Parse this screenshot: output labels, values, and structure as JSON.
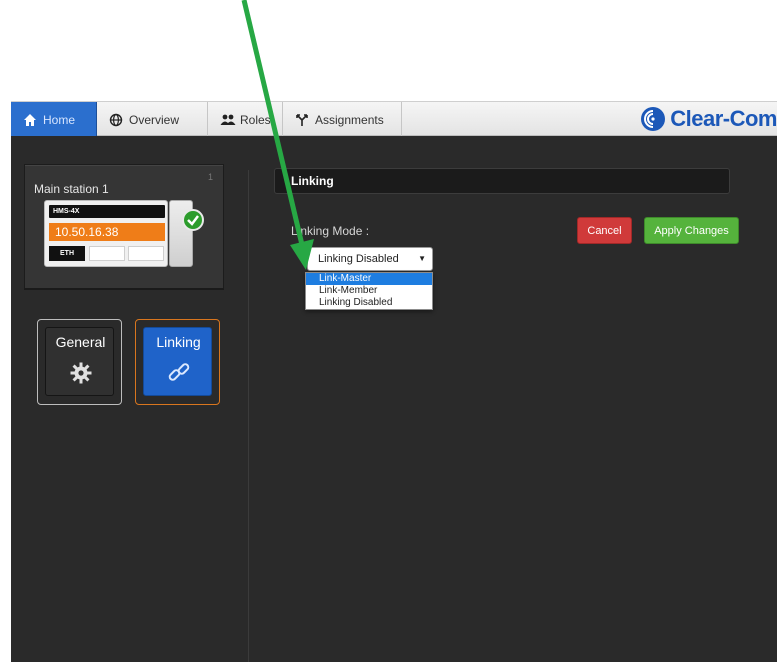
{
  "nav": {
    "tabs": [
      {
        "label": "Home",
        "icon": "home-icon"
      },
      {
        "label": "Overview",
        "icon": "globe-icon"
      },
      {
        "label": "Roles",
        "icon": "users-icon"
      },
      {
        "label": "Assignments",
        "icon": "assignments-icon"
      }
    ],
    "active_tab": "Home",
    "brand": "Clear-Com"
  },
  "station": {
    "name": "Main station 1",
    "number": "1",
    "model": "HMS-4X",
    "ip": "10.50.16.38",
    "port": "ETH",
    "status_icon": "check-icon"
  },
  "nav_tiles": [
    {
      "label": "General",
      "icon": "gear-icon"
    },
    {
      "label": "Linking",
      "icon": "link-icon",
      "selected": true
    }
  ],
  "panel": {
    "section_title": "Linking",
    "mode_label": "Linking Mode :",
    "selected_value": "Linking Disabled",
    "options": [
      "Link-Master",
      "Link-Member",
      "Linking Disabled"
    ],
    "highlighted_option": "Link-Master",
    "cancel_label": "Cancel",
    "apply_label": "Apply Changes"
  },
  "colors": {
    "accent_blue": "#2b6fce",
    "ip_orange": "#ef7d18",
    "cancel_red": "#d03a3a",
    "apply_green": "#55b33c",
    "annotation_arrow": "#27a844",
    "dark_bg": "#2a2a2a"
  }
}
